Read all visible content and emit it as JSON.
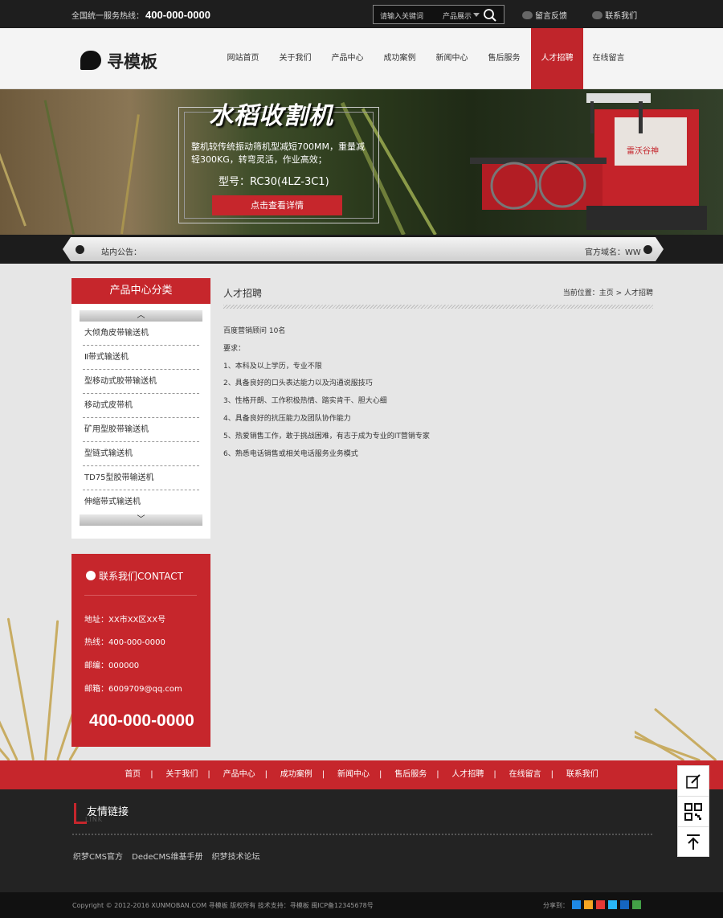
{
  "topbar": {
    "hotline_label": "全国统一服务热线：",
    "hotline_number": "400-000-0000",
    "search_placeholder": "请输入关键词",
    "search_category": "产品展示",
    "feedback": "留言反馈",
    "contact": "联系我们"
  },
  "header": {
    "logo_text": "寻模板",
    "nav": [
      "网站首页",
      "关于我们",
      "产品中心",
      "成功案例",
      "新闻中心",
      "售后服务",
      "人才招聘",
      "在线留言"
    ],
    "active_nav": "人才招聘"
  },
  "banner": {
    "title": "水稻收割机",
    "desc": "整机较传统振动筛机型减短700MM，重量减轻300KG，转弯灵活，作业高效；",
    "model": "型号：RC30(4LZ-3C1)",
    "button": "点击查看详情"
  },
  "notice": {
    "label": "站内公告：",
    "domain": "官方域名：WW"
  },
  "sidebar": {
    "title": "产品中心分类",
    "items": [
      "大倾角皮带输送机",
      "Ⅱ带式输送机",
      "型移动式胶带输送机",
      "移动式皮带机",
      "矿用型胶带输送机",
      "型链式输送机",
      "TD75型胶带输送机",
      "伸缩带式输送机"
    ]
  },
  "contact": {
    "title": "联系我们CONTACT",
    "address": "地址：XX市XX区XX号",
    "hotline": "热线：400-000-0000",
    "postcode": "邮编：000000",
    "email": "邮箱：6009709@qq.com",
    "big_phone": "400-000-0000"
  },
  "main": {
    "title": "人才招聘",
    "breadcrumb": "当前位置：主页 > 人才招聘",
    "lines": [
      "百度营销顾问 10名",
      "要求：",
      "1、本科及以上学历，专业不限",
      "2、具备良好的口头表达能力以及沟通说服技巧",
      "3、性格开朗、工作积极热情、踏实肯干、胆大心细",
      "4、具备良好的抗压能力及团队协作能力",
      "5、热爱销售工作，敢于挑战困难，有志于成为专业的IT营销专家",
      "6、熟悉电话销售或相关电话服务业务模式"
    ]
  },
  "footer_nav": [
    "首页",
    "关于我们",
    "产品中心",
    "成功案例",
    "新闻中心",
    "售后服务",
    "人才招聘",
    "在线留言",
    "联系我们"
  ],
  "footer": {
    "links_title": "友情链接",
    "links_sub": "LINK",
    "links": [
      "织梦CMS官方",
      "DedeCMS维基手册",
      "织梦技术论坛"
    ],
    "copyright": "Copyright © 2012-2016 XUNMOBAN.COM 寻模板 版权所有    技术支持：寻模板    闽ICP备12345678号",
    "share_label": "分享到："
  },
  "colors": {
    "brand_red": "#c6262c",
    "dark": "#1e1e1e"
  },
  "icons": [
    "search-icon",
    "chat-icon",
    "user-icon",
    "notice-icon",
    "chevron-up-icon",
    "chevron-down-icon",
    "edit-icon",
    "qrcode-icon",
    "back-to-top-icon"
  ]
}
